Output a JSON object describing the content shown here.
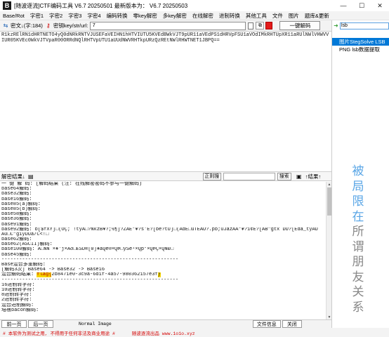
{
  "window": {
    "logo_text": "B",
    "title": "[随波逐流]CTF编码工具 V6.7 20250501   最新版本为： V6.7 20250503",
    "controls": [
      "—",
      "☐",
      "✕"
    ]
  },
  "menu": [
    "Base/Rot",
    "字密1",
    "字密2",
    "字密3",
    "字密4",
    "编码转换",
    "零key解密",
    "多key解密",
    "在线解密",
    "进制转换",
    "其他工具",
    "文件",
    "图片",
    "题库&更新"
  ],
  "toolbar": {
    "cipher_label": "密文↓(字:184)",
    "key_label": "密钥key/str/url:",
    "key_value": "7",
    "decode_button": "一键解码",
    "accent_color": "#e31b1b"
  },
  "input": {
    "text": "R1kzRElRN1dHRTNETO4yQ0dNRkRNTVJUSEFaVEIHN1hHTVIUTU5KVEdBWkVJT9pUR11aVEdPS1dHRVpFSU1aVOdIMkRHTUpXR11aRUlNWlVHWVVIUR05KVEc0WkVJTVpaR00ORRdNQlRHTVpUTU1aUUdNWVRHTkpURzQzREtNWlRHWTNET1JBPQ=="
  },
  "middle_bar": {
    "result_label": "解密结果↓",
    "regex_button": "正则搜",
    "search_button": "搜索",
    "result_nav": "↑结果↑"
  },
  "result": {
    "lines": [
      {
        "t": "一 键 解 码:     [解码结果 (注: 在线解密密码不参与一键解码)"
      },
      {
        "t": "base64解码:"
      },
      {
        "t": "base32解码:"
      },
      {
        "t": "base16解码:"
      },
      {
        "t": "base85(a)解码:"
      },
      {
        "t": "base85(b)解码:"
      },
      {
        "t": "base58解码:"
      },
      {
        "t": "base36解码:"
      },
      {
        "t": "base91解码:"
      },
      {
        "t": "base92解码:        b[$fXY]□(OÇ;¯!tyÃ□?NkzB¥?;½¶]?ZAÊ°¥?s'Ê?[be?tU]□(ÃdÊ□uTÊAU?.þb;ûJazÃÃ°¥?1¢Ê?[ÂB\"gtx DÚ?[Êdâ_tyÃU"
      },
      {
        "t": "ÃO□C\"g1yDUa/C<!□"
      },
      {
        "t": "base62解码:"
      },
      {
        "t": "base62(ASCII)解码:"
      },
      {
        "t": "base100解码:       Ã□ÑN ×¥'j×Ãð□ÊSD®[0]¥âQê®×QÞ□ySê¹×Qþ*×QÞÇ×QÑÐ□"
      },
      {
        "t": "base45解码:"
      },
      {
        "t": "------------------------------------------------------------"
      },
      {
        "t": "Base混合多重解码:"
      },
      {
        "t": "[解码3次] Base64 -> Base32 -> Base16"
      },
      {
        "t": "混合解码结果: ",
        "flag": "flag{",
        "rest": "2b8471e0-3c9a-6d1f-4a57-980362157e3f",
        "tail": "}"
      },
      {
        "t": "------------------------------------------------------------"
      },
      {
        "t": "16进制转字符:"
      },
      {
        "t": "10进制转字符:"
      },
      {
        "t": "8进制转字符:"
      },
      {
        "t": "2进制转字符:"
      },
      {
        "t": "混合进制解码:"
      },
      {
        "t": "培根bacon解码:"
      }
    ]
  },
  "bottom": {
    "prev_button": "前一页",
    "next_button": "后一页",
    "mode_normal": "Normal Image",
    "file_info": "文件信息",
    "close_button": "关闭"
  },
  "status": {
    "warning": "# 本软件为测试之用, 不得用于任何非法及商业用途 #",
    "site": "随波逐流出品 www.1o1o.xyz",
    "warn_color": "#d40000"
  },
  "right_panel": {
    "search_value": "lsb",
    "plugins": [
      {
        "label": "图片StegSolve LSB",
        "selected": true
      },
      {
        "label": "PNG lsb数据提取",
        "selected": false
      }
    ],
    "slogan_chars": [
      "被",
      "局",
      "限",
      "在",
      "所",
      "谓",
      "朋",
      "友",
      "关",
      "系"
    ],
    "slogan_color": "#5aa6e6"
  }
}
